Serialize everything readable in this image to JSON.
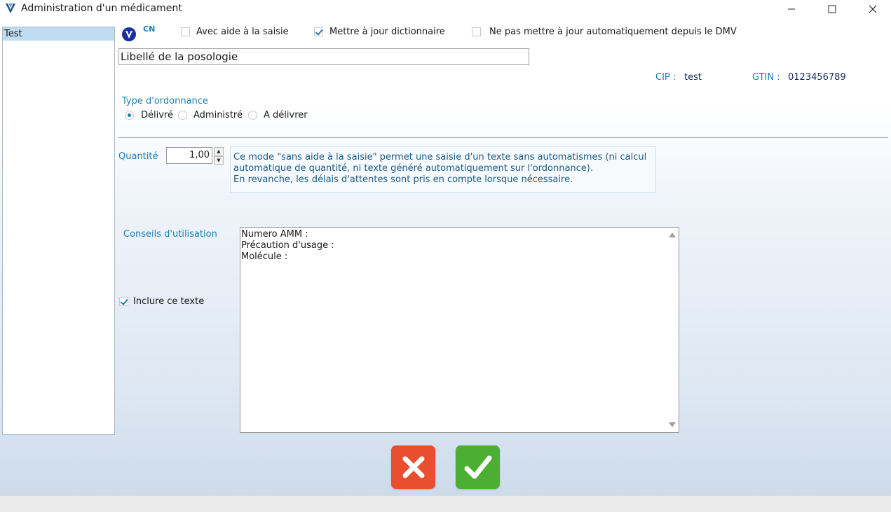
{
  "window": {
    "title": "Administration d'un médicament",
    "controls": [
      "minimize-icon",
      "maximize-icon",
      "close-icon"
    ]
  },
  "left_list": {
    "items": [
      {
        "label": "Test",
        "selected": true
      }
    ]
  },
  "header": {
    "cn_label": "CN",
    "checkboxes": [
      {
        "label": "Avec aide à la saisie",
        "checked": false
      },
      {
        "label": "Mettre à jour dictionnaire",
        "checked": true
      },
      {
        "label": "Ne pas mettre à jour automatiquement depuis le DMV",
        "checked": false
      }
    ]
  },
  "posologie": {
    "value": "Libellé de la posologie"
  },
  "identifiers": {
    "cip_label": "CIP :",
    "cip_value": "test",
    "gtin_label": "GTIN :",
    "gtin_value": "0123456789"
  },
  "ordonnance": {
    "label": "Type d'ordonnance",
    "options": [
      {
        "label": "Délivré",
        "selected": true
      },
      {
        "label": "Administré",
        "selected": false
      },
      {
        "label": "A délivrer",
        "selected": false
      }
    ]
  },
  "quantite": {
    "label": "Quantité",
    "value": "1,00"
  },
  "info": {
    "lines": [
      "Ce mode \"sans aide à la saisie\" permet une saisie d'un texte sans automatismes (ni calcul",
      "automatique de quantité, ni texte généré automatiquement sur l'ordonnance).",
      "En revanche, les délais d'attentes sont pris en compte lorsque nécessaire."
    ]
  },
  "conseils": {
    "label": "Conseils d'utilisation",
    "lines": [
      "Numero AMM :",
      "Précaution d'usage :",
      "Molécule :"
    ],
    "include_label": "Inclure ce texte",
    "include_checked": true
  },
  "actions": {
    "cancel_icon": "cross-icon",
    "ok_icon": "checkmark-icon"
  },
  "colors": {
    "accent": "#1a7fb5",
    "cancel": "#e94e2e",
    "ok": "#4caf34",
    "selection": "#bfdcf0"
  }
}
